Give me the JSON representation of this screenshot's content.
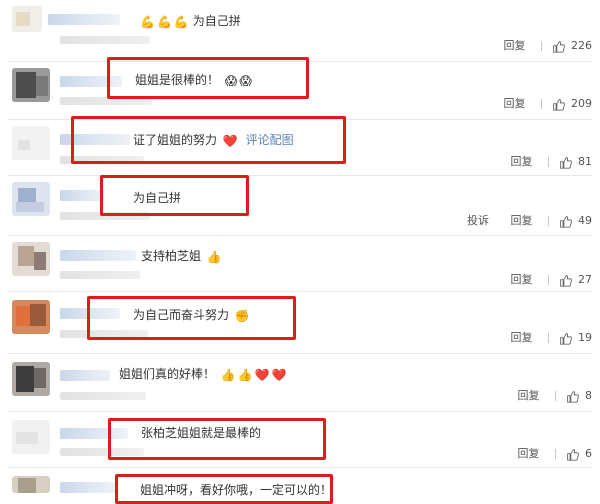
{
  "comments": [
    {
      "text": "为自己拼",
      "emojis": [
        "💪",
        "💪",
        "💪"
      ],
      "emojis_before_text": true,
      "link": "",
      "reply": "回复",
      "likes": "226",
      "report": ""
    },
    {
      "text": "姐姐是很棒的！",
      "emojis": [
        "😱",
        "😱"
      ],
      "link": "",
      "reply": "回复",
      "likes": "209",
      "report": ""
    },
    {
      "text": "证了姐姐的努力",
      "emojis": [
        "❤️"
      ],
      "link": "评论配图",
      "reply": "回复",
      "likes": "81",
      "report": ""
    },
    {
      "text": "为自己拼",
      "emojis": [],
      "link": "",
      "reply": "回复",
      "likes": "49",
      "report": "投诉"
    },
    {
      "text": "支持柏芝姐",
      "emojis": [
        "👍"
      ],
      "link": "",
      "reply": "回复",
      "likes": "27",
      "report": ""
    },
    {
      "text": "为自己而奋斗努力",
      "emojis": [
        "✊"
      ],
      "link": "",
      "reply": "回复",
      "likes": "19",
      "report": ""
    },
    {
      "text": "姐姐们真的好棒！",
      "emojis": [
        "👍",
        "👍",
        "❤️",
        "❤️"
      ],
      "link": "",
      "reply": "回复",
      "likes": "8",
      "report": ""
    },
    {
      "text": "张柏芝姐姐就是最棒的",
      "emojis": [],
      "link": "",
      "reply": "回复",
      "likes": "6",
      "report": ""
    },
    {
      "text": "姐姐冲呀，看好你哦，一定可以的！",
      "emojis": [],
      "link": "",
      "reply": "",
      "likes": "",
      "report": ""
    }
  ],
  "icons": {
    "like": "thumbs-up-outline-icon"
  },
  "colors": {
    "highlight_border": "#e01b1b",
    "link": "#5b83b8",
    "text": "#333333",
    "action_text": "#555555"
  }
}
